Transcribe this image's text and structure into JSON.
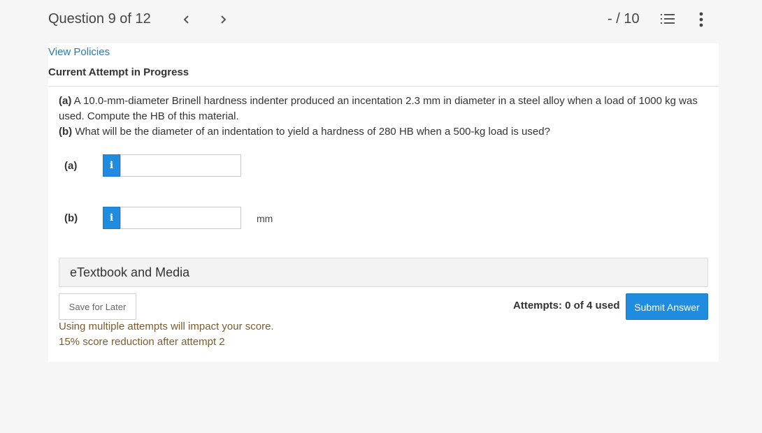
{
  "header": {
    "question_label": "Question 9 of 12",
    "prev_icon": "chevron-left-icon",
    "next_icon": "chevron-right-icon",
    "score": "- / 10",
    "list_icon": "numbered-list-icon",
    "more_icon": "vertical-ellipsis-icon"
  },
  "content": {
    "view_policies": "View Policies",
    "attempt_status": "Current Attempt in Progress",
    "question": {
      "part_a_prefix": "(a)",
      "part_a_text": " A 10.0-mm-diameter Brinell hardness indenter produced an incentation 2.3 mm in diameter in a steel alloy when a load of 1000 kg was used. Compute the HB of this material.",
      "part_b_prefix": "(b)",
      "part_b_text": " What will be the diameter of an indentation to yield a hardness of 280 HB when a 500-kg load is used?"
    },
    "answers": [
      {
        "label": "(a)",
        "info_glyph": "i",
        "value": "",
        "unit": ""
      },
      {
        "label": "(b)",
        "info_glyph": "i",
        "value": "",
        "unit": "mm"
      }
    ],
    "etextbook": "eTextbook and Media",
    "save_label": "Save for Later",
    "attempts": "Attempts: 0 of 4 used",
    "submit_label": "Submit Answer",
    "notes": [
      "Using multiple attempts will impact your score.",
      "15% score reduction after attempt 2"
    ]
  },
  "colors": {
    "accent": "#1f8ce0",
    "link": "#2a7ab0",
    "note_text": "#7a5c2e",
    "background": "#f6f6f6",
    "panel": "#ffffff"
  }
}
